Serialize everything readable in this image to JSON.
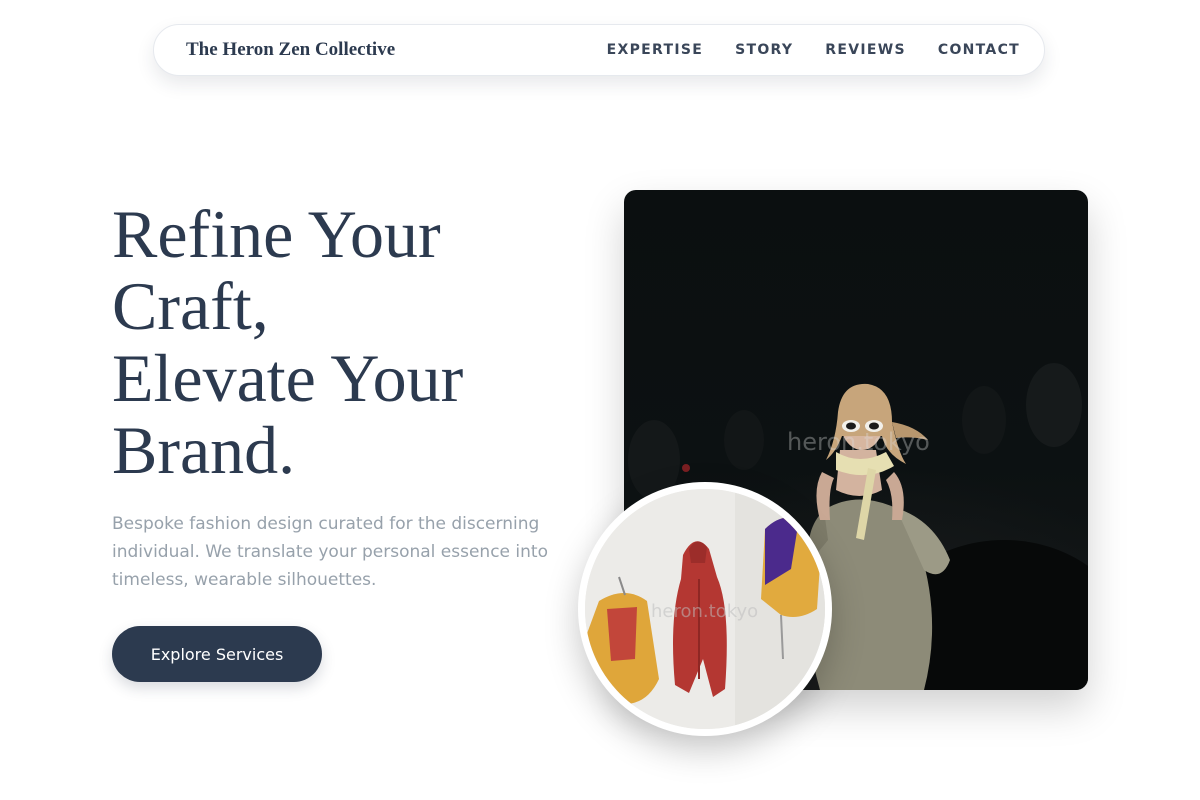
{
  "nav": {
    "brand": "The Heron Zen Collective",
    "links": [
      {
        "label": "EXPERTISE"
      },
      {
        "label": "STORY"
      },
      {
        "label": "REVIEWS"
      },
      {
        "label": "CONTACT"
      }
    ]
  },
  "hero": {
    "title_lines": [
      "Refine Your",
      "Craft,",
      "Elevate Your",
      "Brand."
    ],
    "description": "Bespoke fashion design curated for the discerning individual. We translate your personal essence into timeless, wearable silhouettes.",
    "cta_label": "Explore Services"
  },
  "images": {
    "main_watermark": "heron.tokyo",
    "circle_watermark": "heron.tokyo"
  },
  "colors": {
    "primary": "#2c3a4f",
    "muted_text": "#97a1ab",
    "background": "#ffffff"
  }
}
